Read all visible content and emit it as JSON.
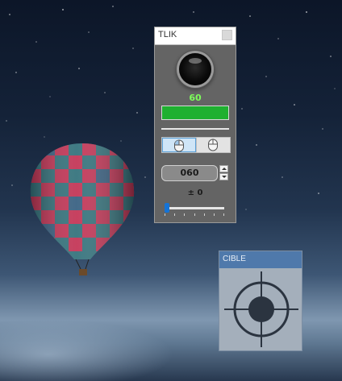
{
  "desktop": {
    "background_colors": {
      "sky_top": "#0c1628",
      "horizon": "#7f97b0",
      "water": "#27384f"
    }
  },
  "tlik_window": {
    "title": "TLIK",
    "counter_value": "60",
    "counter_color": "#7CFC5A",
    "progress_fraction": 1.0,
    "progress_color": "#1fb030",
    "mouse_buttons": [
      {
        "name": "left-click",
        "icon": "mouse-left-icon",
        "selected": true
      },
      {
        "name": "right-click",
        "icon": "mouse-right-icon",
        "selected": false
      }
    ],
    "interval_value": "060",
    "offset_label": "± 0",
    "slider_fraction": 0.0,
    "slider_color": "#1573d6"
  },
  "cible_window": {
    "title": "CIBLE",
    "titlebar_color": "#4f79ab",
    "icon": "crosshair-target-icon"
  }
}
